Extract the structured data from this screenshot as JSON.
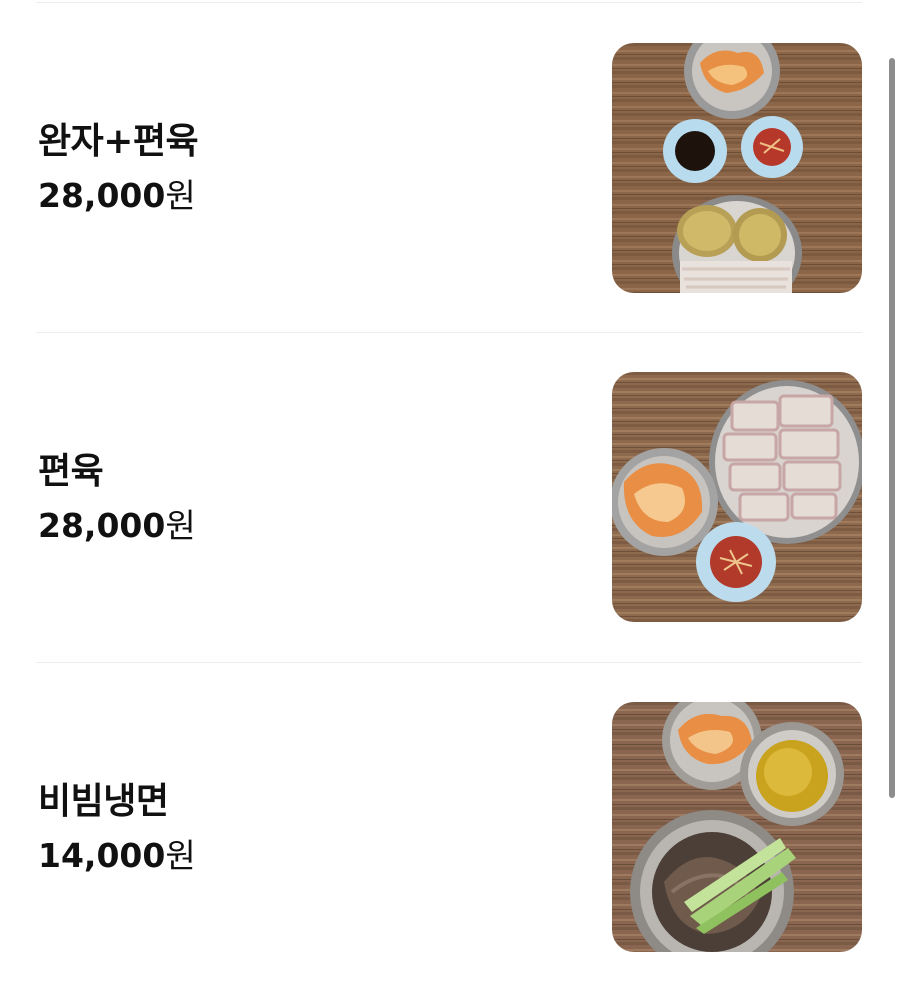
{
  "menu": {
    "items": [
      {
        "name": "완자+편육",
        "price": "28,000",
        "currency": "원",
        "photo": "wanja-pyeonyuk-photo"
      },
      {
        "name": "편육",
        "price": "28,000",
        "currency": "원",
        "photo": "pyeonyuk-photo"
      },
      {
        "name": "비빔냉면",
        "price": "14,000",
        "currency": "원",
        "photo": "bibim-naengmyeon-photo"
      }
    ]
  },
  "colors": {
    "wood": "#8a6548",
    "divider": "#ececec",
    "text": "#111111",
    "scrollbar": "#8d8d8d"
  }
}
